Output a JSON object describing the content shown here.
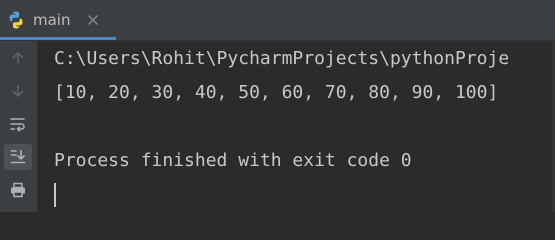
{
  "tab": {
    "label": "main",
    "icon": "python-icon",
    "close_icon": "close-icon",
    "accent_color": "#4a88c7"
  },
  "gutter": {
    "buttons": [
      {
        "icon": "arrow-up-icon",
        "active": false
      },
      {
        "icon": "arrow-down-icon",
        "active": false
      },
      {
        "icon": "soft-wrap-icon",
        "active": false
      },
      {
        "icon": "scroll-to-end-icon",
        "active": true
      },
      {
        "icon": "print-icon",
        "active": false
      }
    ]
  },
  "console": {
    "lines": [
      "C:\\Users\\Rohit\\PycharmProjects\\pythonProje",
      "[10, 20, 30, 40, 50, 60, 70, 80, 90, 100]",
      "",
      "Process finished with exit code 0"
    ],
    "background": "#2b2b2b",
    "text_color": "#c8c8c8"
  }
}
